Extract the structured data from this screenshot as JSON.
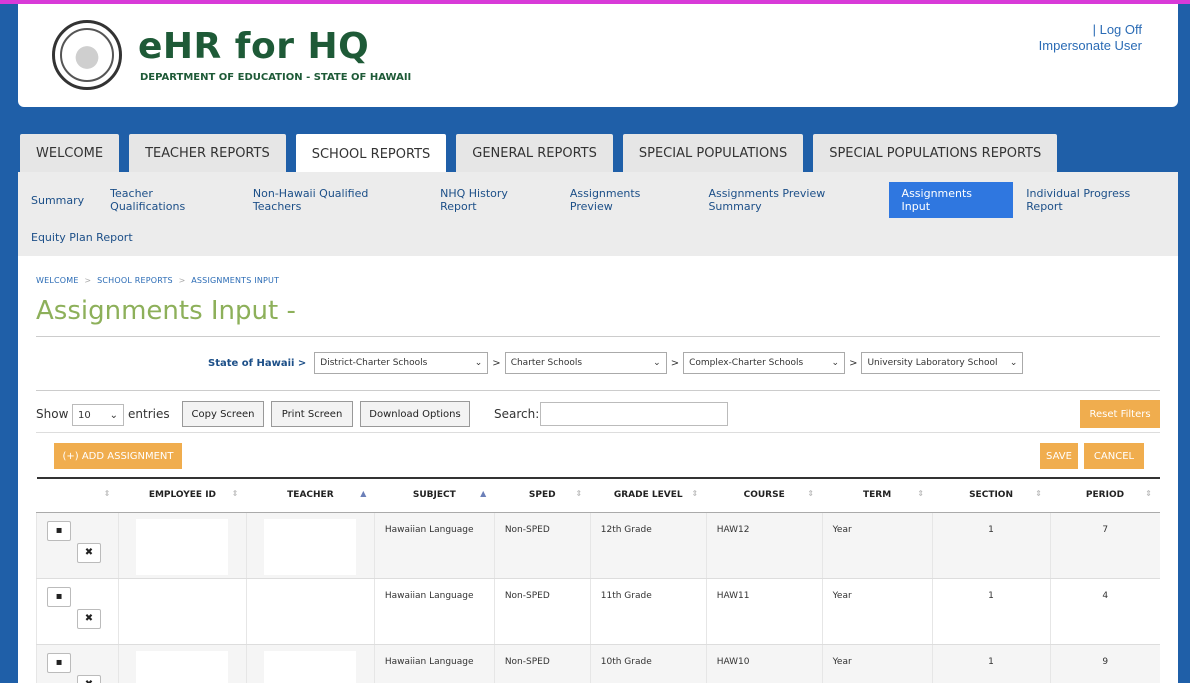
{
  "header": {
    "title": "eHR for HQ",
    "subtitle": "DEPARTMENT OF EDUCATION - STATE OF HAWAII",
    "logo_text": "DEPARTMENT OF EDUCATION STATE OF HAWAII",
    "log_off": "| Log Off",
    "impersonate": "Impersonate User"
  },
  "main_tabs": [
    {
      "label": "WELCOME"
    },
    {
      "label": "TEACHER REPORTS"
    },
    {
      "label": "SCHOOL REPORTS"
    },
    {
      "label": "GENERAL REPORTS"
    },
    {
      "label": "SPECIAL POPULATIONS"
    },
    {
      "label": "SPECIAL POPULATIONS REPORTS"
    }
  ],
  "sub_nav": [
    {
      "label": "Summary"
    },
    {
      "label": "Teacher Qualifications"
    },
    {
      "label": "Non-Hawaii Qualified Teachers"
    },
    {
      "label": "NHQ History Report"
    },
    {
      "label": "Assignments Preview"
    },
    {
      "label": "Assignments Preview Summary"
    },
    {
      "label": "Assignments Input"
    },
    {
      "label": "Individual Progress Report"
    },
    {
      "label": "Equity Plan Report"
    }
  ],
  "breadcrumb": [
    "WELCOME",
    "SCHOOL REPORTS",
    "ASSIGNMENTS INPUT"
  ],
  "breadcrumb_sep": ">",
  "page_title": "Assignments Input -",
  "filters": {
    "root_label": "State of Hawaii >",
    "sep": ">",
    "district": "District-Charter Schools",
    "charter": "Charter Schools",
    "complex": "Complex-Charter Schools",
    "school": "University Laboratory School",
    "chevron": "⌄"
  },
  "controls": {
    "show": "Show",
    "length": "10",
    "entries": "entries",
    "copy": "Copy Screen",
    "print": "Print Screen",
    "download": "Download Options",
    "search_label": "Search:",
    "search_value": "",
    "reset": "Reset Filters"
  },
  "table": {
    "add_label": "(+) ADD ASSIGNMENT",
    "save_label": "SAVE",
    "cancel_label": "CANCEL",
    "columns": [
      "",
      "EMPLOYEE ID",
      "TEACHER",
      "SUBJECT",
      "SPED",
      "GRADE LEVEL",
      "COURSE",
      "TERM",
      "SECTION",
      "PERIOD"
    ],
    "rows": [
      {
        "subject": "Hawaiian Language",
        "sped": "Non-SPED",
        "grade": "12th Grade",
        "course": "HAW12",
        "term": "Year",
        "section": "1",
        "period": "7"
      },
      {
        "subject": "Hawaiian Language",
        "sped": "Non-SPED",
        "grade": "11th Grade",
        "course": "HAW11",
        "term": "Year",
        "section": "1",
        "period": "4"
      },
      {
        "subject": "Hawaiian Language",
        "sped": "Non-SPED",
        "grade": "10th Grade",
        "course": "HAW10",
        "term": "Year",
        "section": "1",
        "period": "9"
      }
    ]
  },
  "icons": {
    "sort_both": "⇕",
    "sort_asc": "▲",
    "file": "▪",
    "delete": "✖"
  },
  "colors": {
    "brand_blue": "#1f5fa8",
    "accent_orange": "#f0ad4e",
    "active_tab": "#2f77e0",
    "title_green": "#8db05a",
    "header_green": "#1e5a37"
  }
}
